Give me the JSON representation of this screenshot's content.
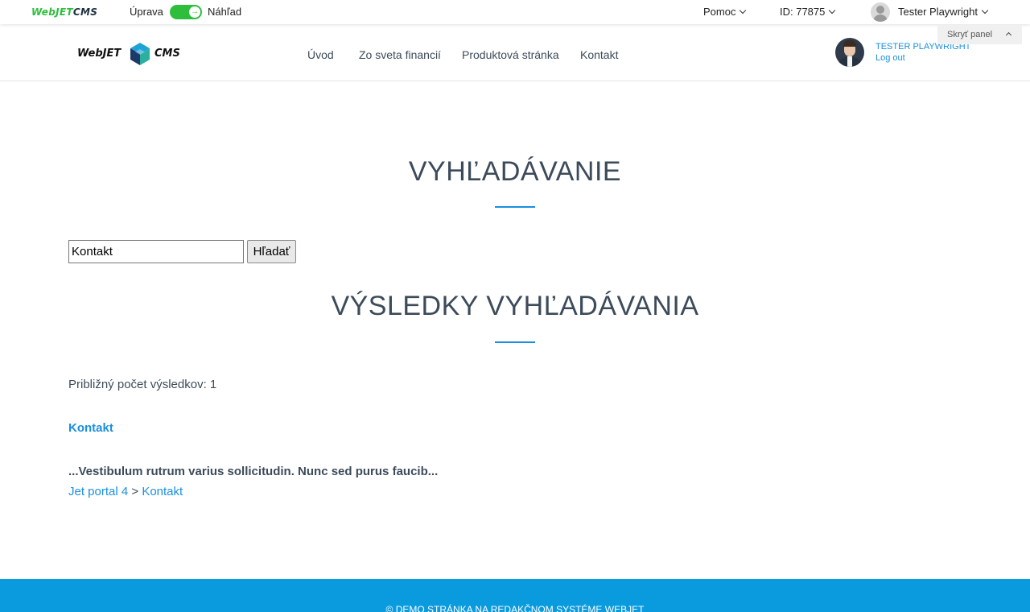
{
  "admin_bar": {
    "logo_green": "WebJET",
    "logo_dark": "CMS",
    "mode_edit": "Úprava",
    "mode_preview": "Náhľad",
    "help": "Pomoc",
    "page_id": "ID: 77875",
    "user": "Tester Playwright",
    "hide_panel": "Skryť panel"
  },
  "header": {
    "logo_left": "WebJET",
    "logo_right": "CMS",
    "nav": [
      "Úvod",
      "Zo sveta financií",
      "Produktová stránka",
      "Kontakt"
    ],
    "user_name": "TESTER PLAYWRIGHT",
    "logout": "Log out"
  },
  "main": {
    "title": "VYHĽADÁVANIE",
    "search_value": "Kontakt",
    "search_button": "Hľadať",
    "results_title": "VÝSLEDKY VYHĽADÁVANIA",
    "count": "Približný počet výsledkov: 1",
    "result": {
      "title": "Kontakt",
      "snippet": "...Vestibulum rutrum varius sollicitudin. Nunc sed purus faucib...",
      "crumb_root": "Jet portal 4",
      "crumb_sep": ">",
      "crumb_page": "Kontakt"
    }
  },
  "footer": {
    "text": "© DEMO STRÁNKA NA REDAKČNOM SYSTÉME WEBJET"
  }
}
